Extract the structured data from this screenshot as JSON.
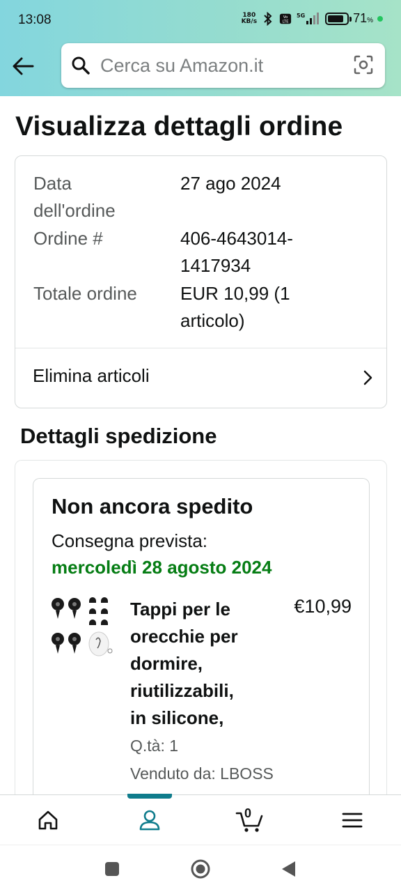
{
  "status_bar": {
    "time": "13:08",
    "net_speed_value": "180",
    "net_speed_unit": "KB/s",
    "network": "5G",
    "battery_percent": "71",
    "battery_unit": "%",
    "icons": [
      "bluetooth-icon",
      "volte-icon",
      "signal-icon",
      "battery-icon"
    ]
  },
  "header": {
    "search_placeholder": "Cerca su Amazon.it"
  },
  "page": {
    "title": "Visualizza dettagli ordine"
  },
  "order_summary": {
    "date_label_line1": "Data",
    "date_label_line2": "dell'ordine",
    "date_value": "27 ago 2024",
    "order_label": "Ordine #",
    "order_value_line1": "406-4643014-",
    "order_value_line2": "1417934",
    "total_label": "Totale ordine",
    "total_value_line1": "EUR 10,99 (1",
    "total_value_line2": "articolo)",
    "delete_items": "Elimina articoli"
  },
  "shipping": {
    "section_title": "Dettagli spedizione",
    "status": "Non ancora spedito",
    "eta_label": "Consegna prevista:",
    "eta_date": "mercoledì 28 agosto 2024",
    "eta_color": "#067d14",
    "item": {
      "title_lines": [
        "Tappi per le",
        "orecchie per",
        "dormire,",
        "riutilizzabili,",
        "in silicone,"
      ],
      "price": "€10,99",
      "qty": "Q.tà: 1",
      "seller": "Venduto da: LBOSS"
    }
  },
  "bottom_nav": {
    "items": [
      "home-icon",
      "account-icon",
      "cart-icon",
      "menu-icon"
    ],
    "active": "account-icon",
    "cart_count": "0",
    "accent": "#0f7c8c"
  },
  "system_nav": {
    "items": [
      "recents-button",
      "home-button",
      "back-button"
    ]
  }
}
